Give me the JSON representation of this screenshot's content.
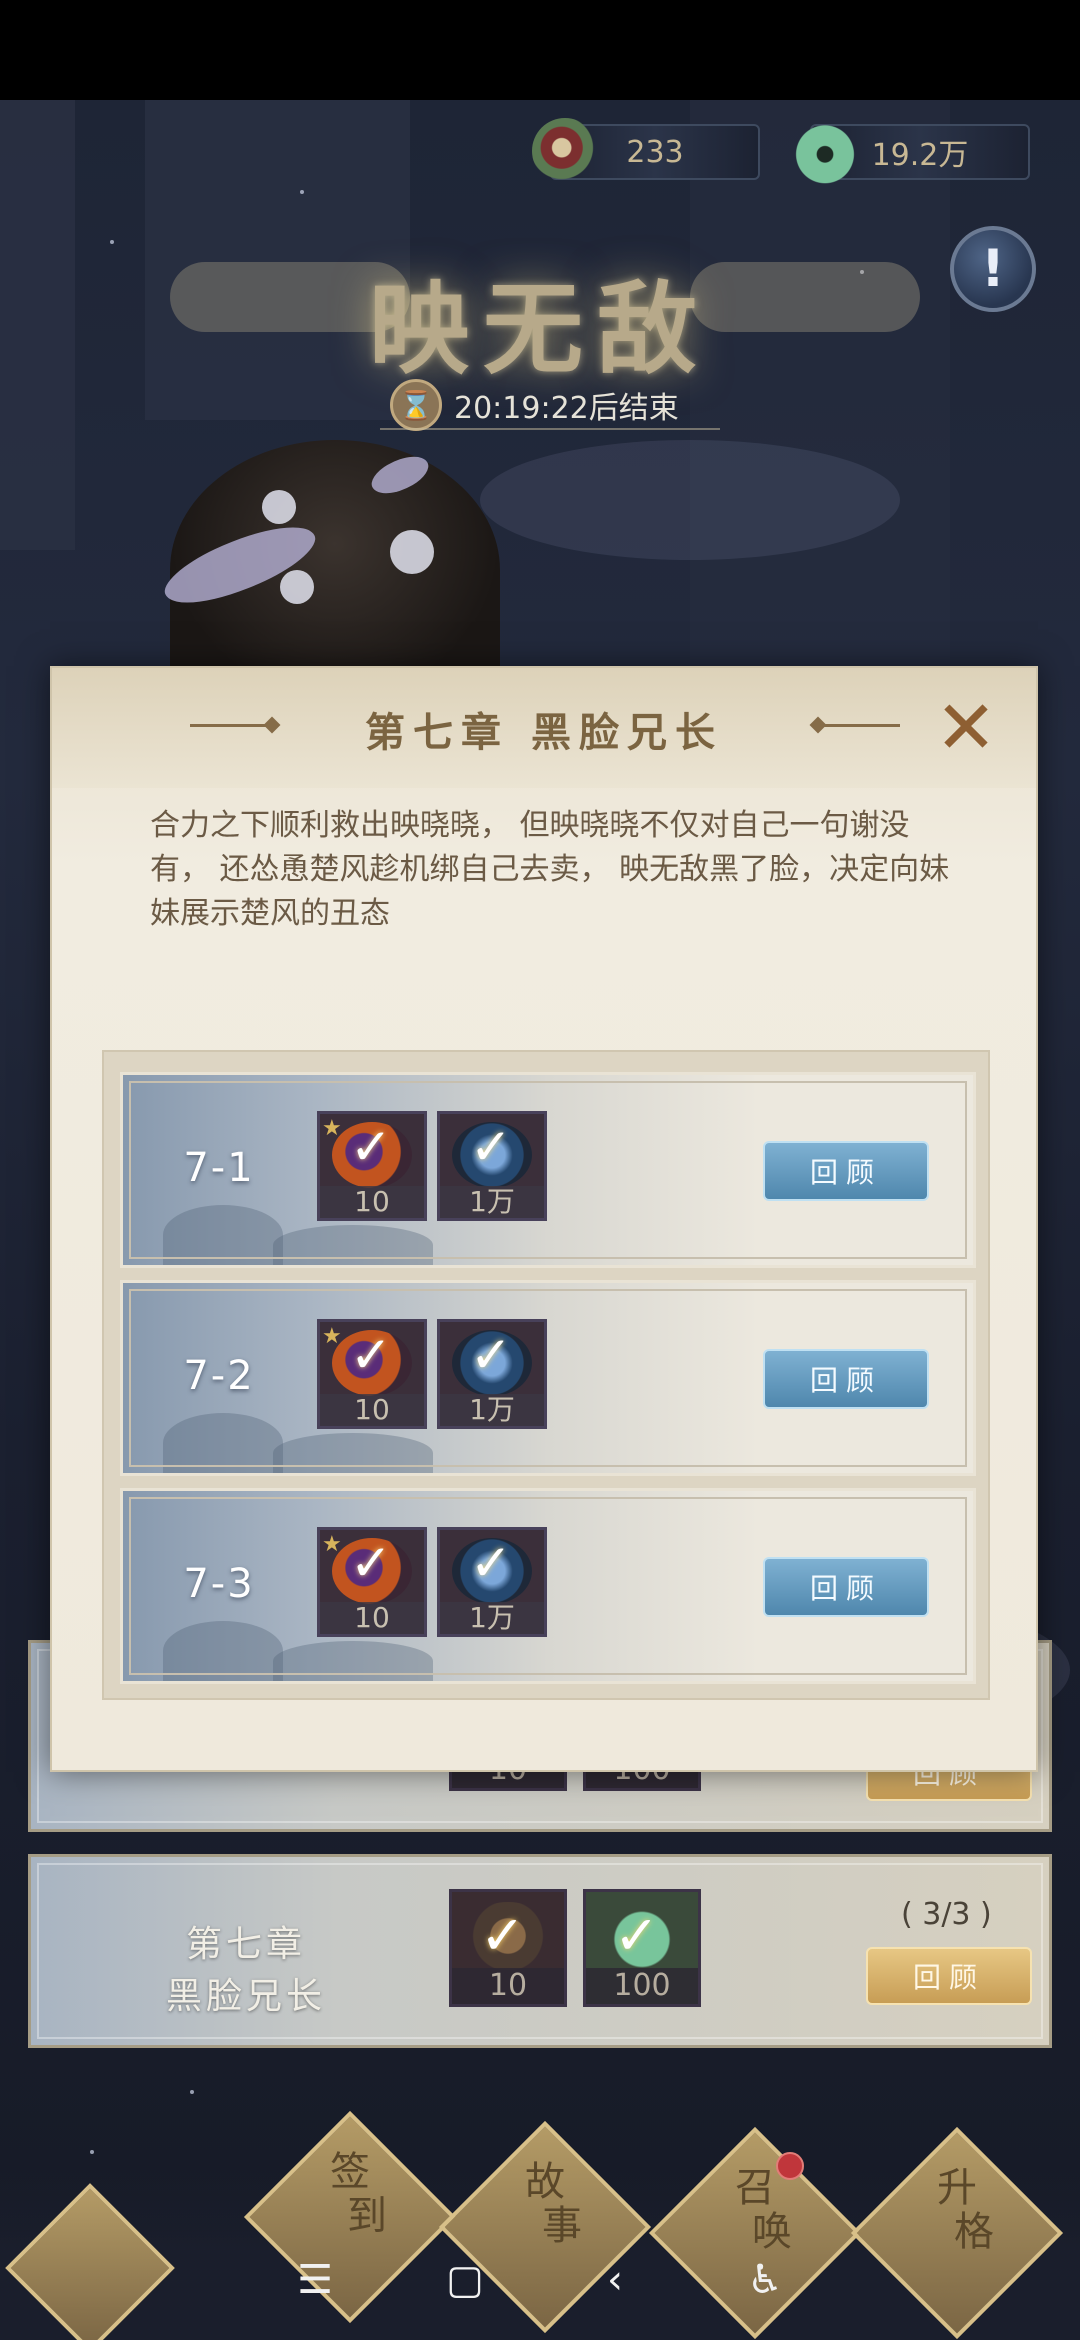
{
  "resources": [
    {
      "value": "233",
      "icon": "scroll-icon"
    },
    {
      "value": "19.2万",
      "icon": "jade-coin-icon"
    }
  ],
  "event": {
    "title": "映无敌",
    "timer": "20:19:22后结束"
  },
  "chapter_list": [
    {
      "title_line1": "",
      "title_line2": "",
      "reward1": "10",
      "reward2": "100",
      "progress": "",
      "button": "回顾"
    },
    {
      "title_line1": "第七章",
      "title_line2": "黑脸兄长",
      "reward1": "10",
      "reward2": "100",
      "progress": "( 3/3 )",
      "button": "回顾"
    }
  ],
  "dialog": {
    "title": "第七章 黑脸兄长",
    "close_icon": "close-x-icon",
    "description": "合力之下顺利救出映晓晓， 但映晓晓不仅对自己一句谢没有， 还怂恿楚风趁机绑自己去卖， 映无敌黑了脸，决定向妹妹展示楚风的丑态",
    "stages": [
      {
        "label": "7-1",
        "reward1": "10",
        "reward2": "1万",
        "button": "回顾"
      },
      {
        "label": "7-2",
        "reward1": "10",
        "reward2": "1万",
        "button": "回顾"
      },
      {
        "label": "7-3",
        "reward1": "10",
        "reward2": "1万",
        "button": "回顾"
      }
    ]
  },
  "bottom_nav": [
    {
      "label_line1": "签",
      "label_line2": "到"
    },
    {
      "label_line1": "故",
      "label_line2": "事"
    },
    {
      "label_line1": "召",
      "label_line2": "唤"
    },
    {
      "label_line1": "升",
      "label_line2": "格"
    }
  ],
  "system_nav": {
    "menu": "☰",
    "home": "▢",
    "back": "‹",
    "accessibility": "♿"
  }
}
